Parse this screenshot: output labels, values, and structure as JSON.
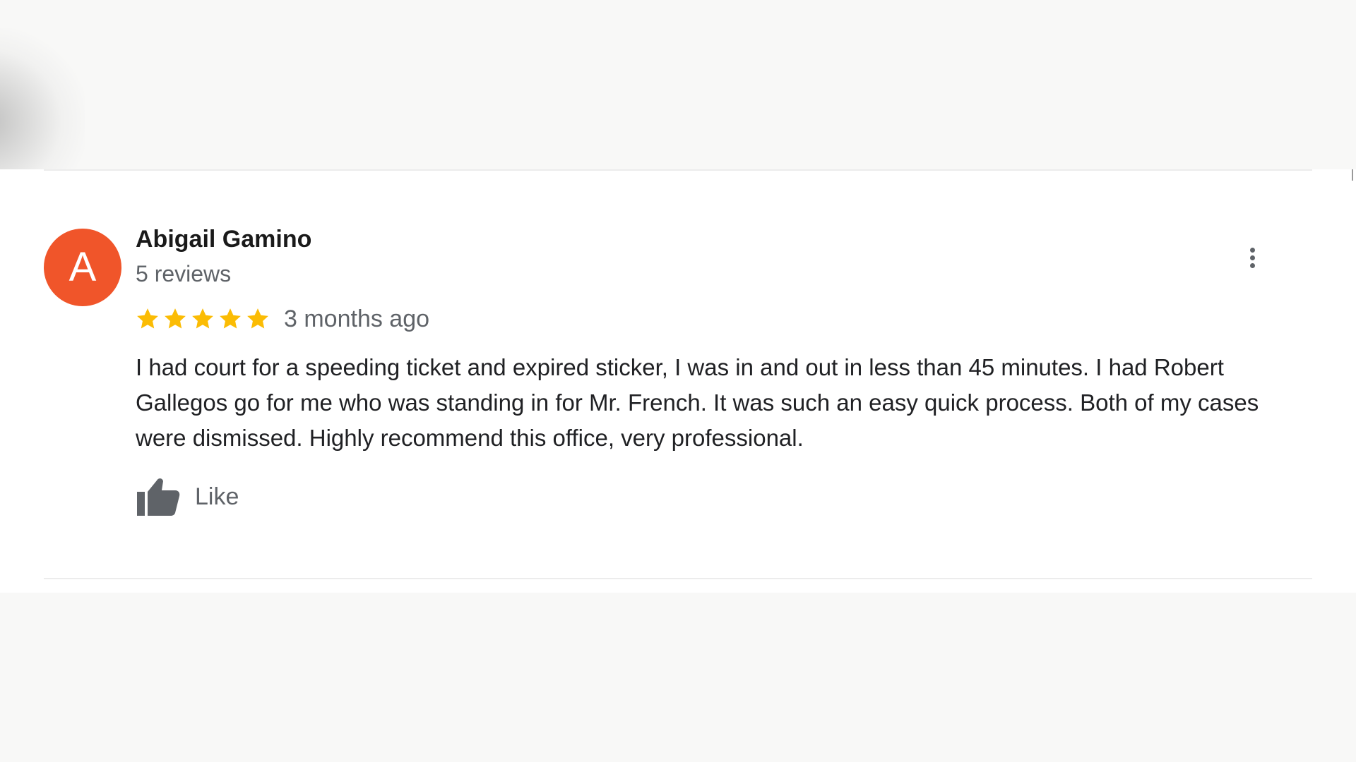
{
  "review": {
    "author": {
      "initial": "A",
      "name": "Abigail Gamino",
      "review_count": "5 reviews",
      "avatar_color": "#f0552a"
    },
    "rating": {
      "stars": 5,
      "max_stars": 5,
      "star_color": "#fbbc04"
    },
    "time_ago": "3 months ago",
    "text": "I had court for a speeding ticket and expired sticker, I was in and out in less than 45 minutes. I had Robert Gallegos go for me who was standing in for Mr. French. It was such an easy quick process. Both of my cases were dismissed. Highly recommend this office, very professional.",
    "actions": {
      "like_label": "Like",
      "like_icon": "thumbs-up-icon",
      "more_icon": "more-vert-icon"
    }
  }
}
